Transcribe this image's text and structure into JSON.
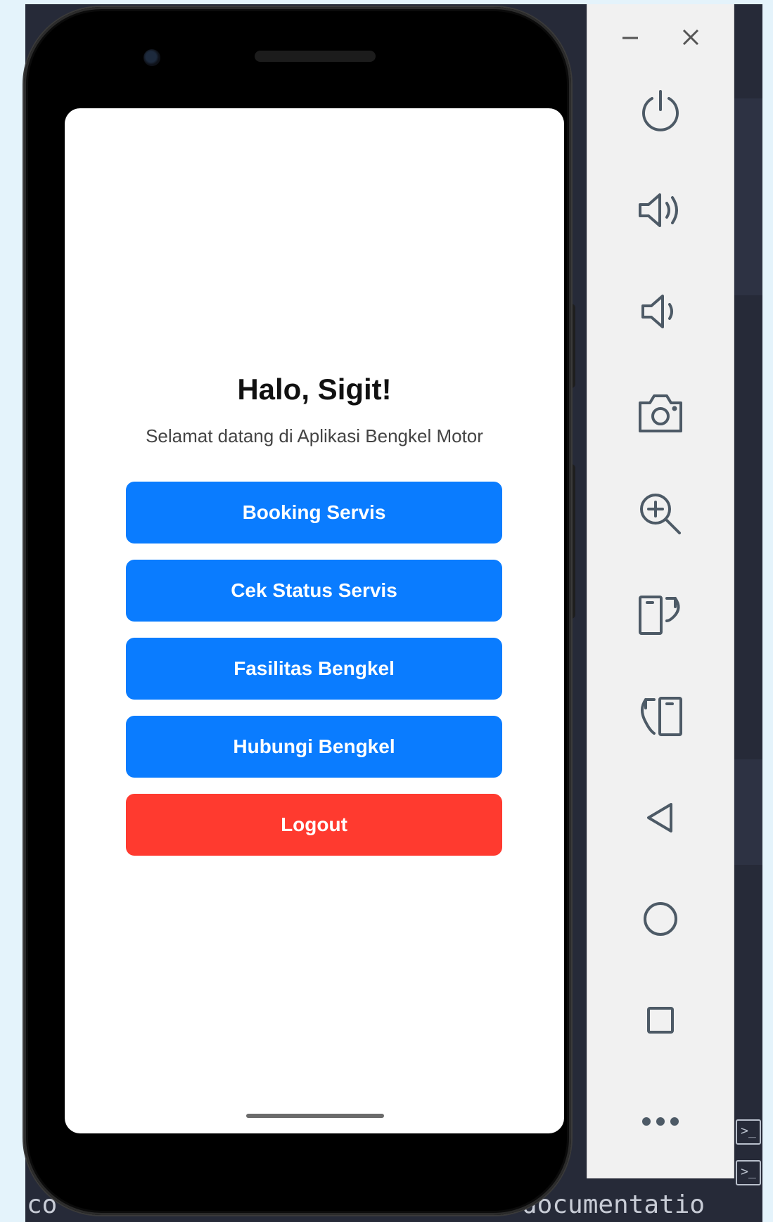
{
  "app": {
    "greeting": "Halo, Sigit!",
    "subtitle": "Selamat datang di Aplikasi Bengkel Motor",
    "buttons": [
      {
        "label": "Booking Servis",
        "color": "#0a7cff"
      },
      {
        "label": "Cek Status Servis",
        "color": "#0a7cff"
      },
      {
        "label": "Fasilitas Bengkel",
        "color": "#0a7cff"
      },
      {
        "label": "Hubungi Bengkel",
        "color": "#0a7cff"
      },
      {
        "label": "Logout",
        "color": "#ff3a2f"
      }
    ]
  },
  "emulator_toolbar": {
    "window_controls": [
      "minimize-icon",
      "close-icon"
    ],
    "items": [
      "power-icon",
      "volume-up-icon",
      "volume-down-icon",
      "camera-icon",
      "zoom-in-icon",
      "rotate-right-icon",
      "rotate-left-icon",
      "back-icon",
      "home-icon",
      "overview-icon",
      "more-icon"
    ]
  },
  "ide": {
    "bottom_left_text": "co",
    "bottom_right_text": "documentatio"
  },
  "colors": {
    "primary": "#0a7cff",
    "danger": "#ff3a2f",
    "toolbar_icon": "#4d5a66"
  }
}
